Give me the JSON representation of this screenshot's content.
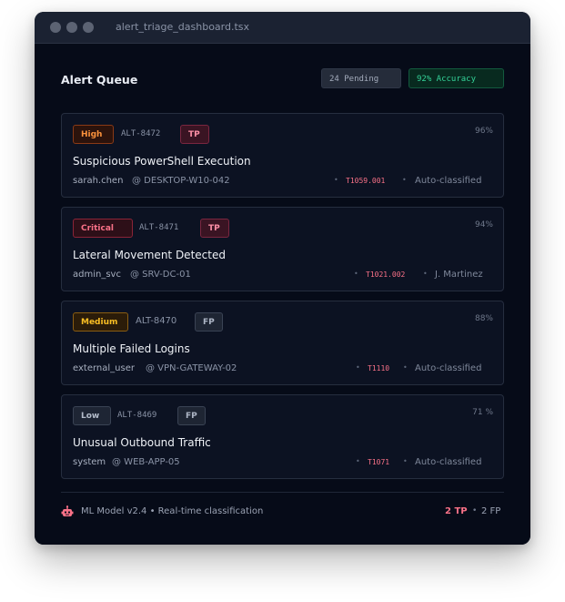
{
  "window": {
    "title": "alert_triage_dashboard.tsx"
  },
  "header": {
    "title": "Alert Queue",
    "pending": "24 Pending",
    "accuracy": "92% Accuracy"
  },
  "alerts": [
    {
      "severity": "High",
      "id": "ALT-8472",
      "verdict": "TP",
      "confidence": "96%",
      "title": "Suspicious PowerShell Execution",
      "user": "sarah.chen",
      "host": "@ DESKTOP-W10-042",
      "mitre": "T1059.001",
      "assignee": "Auto-classified"
    },
    {
      "severity": "Critical",
      "id": "ALT-8471",
      "verdict": "TP",
      "confidence": "94%",
      "title": "Lateral Movement Detected",
      "user": "admin_svc",
      "host": "@ SRV-DC-01",
      "mitre": "T1021.002",
      "assignee": "J. Martinez"
    },
    {
      "severity": "Medium",
      "id": "ALT-8470",
      "verdict": "FP",
      "confidence": "88%",
      "title": "Multiple Failed Logins",
      "user": "external_user",
      "host": "@ VPN-GATEWAY-02",
      "mitre": "T1110",
      "assignee": "Auto-classified"
    },
    {
      "severity": "Low",
      "id": "ALT-8469",
      "verdict": "FP",
      "confidence": "71 %",
      "title": "Unusual Outbound Traffic",
      "user": "system",
      "host": "@ WEB-APP-05",
      "mitre": "T1071",
      "assignee": "Auto-classified"
    }
  ],
  "footer": {
    "model": "ML Model v2.4 • Real-time classification",
    "tp": "2 TP",
    "sep": "•",
    "fp": "2 FP"
  },
  "colors": {
    "tp": "#f87187",
    "accuracy": "#34d399",
    "high": "#fb923c",
    "medium": "#fbbf24"
  },
  "icons": {
    "footer": "robot-icon"
  }
}
